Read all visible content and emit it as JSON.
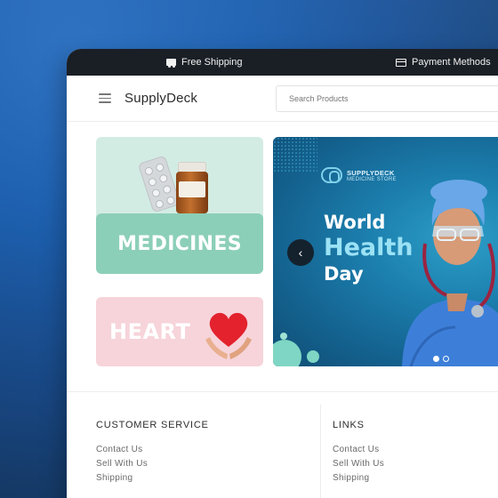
{
  "topbar": {
    "shipping_label": "Free Shipping",
    "payment_label": "Payment Methods"
  },
  "header": {
    "logo": "SupplyDeck",
    "search_placeholder": "Search Products"
  },
  "promos": {
    "medicines_label": "MEDICINES",
    "heart_label": "HEART"
  },
  "banner": {
    "brand_name": "SUPPLYDECK",
    "brand_sub": "MEDICINE STORE",
    "headline_1": "World",
    "headline_2": "Health",
    "headline_3": "Day",
    "slide_count": 2,
    "active_slide": 1
  },
  "footer": {
    "customer_service": {
      "title": "CUSTOMER SERVICE",
      "links": [
        "Contact Us",
        "Sell With Us",
        "Shipping"
      ]
    },
    "links": {
      "title": "LINKS",
      "links": [
        "Contact Us",
        "Sell With Us",
        "Shipping"
      ]
    }
  },
  "colors": {
    "topbar": "#1a1f26",
    "medicines_band": "#8ccfb8",
    "heart_bg": "#f6d4da",
    "banner": "#1c7fae",
    "heart": "#e3222e"
  }
}
